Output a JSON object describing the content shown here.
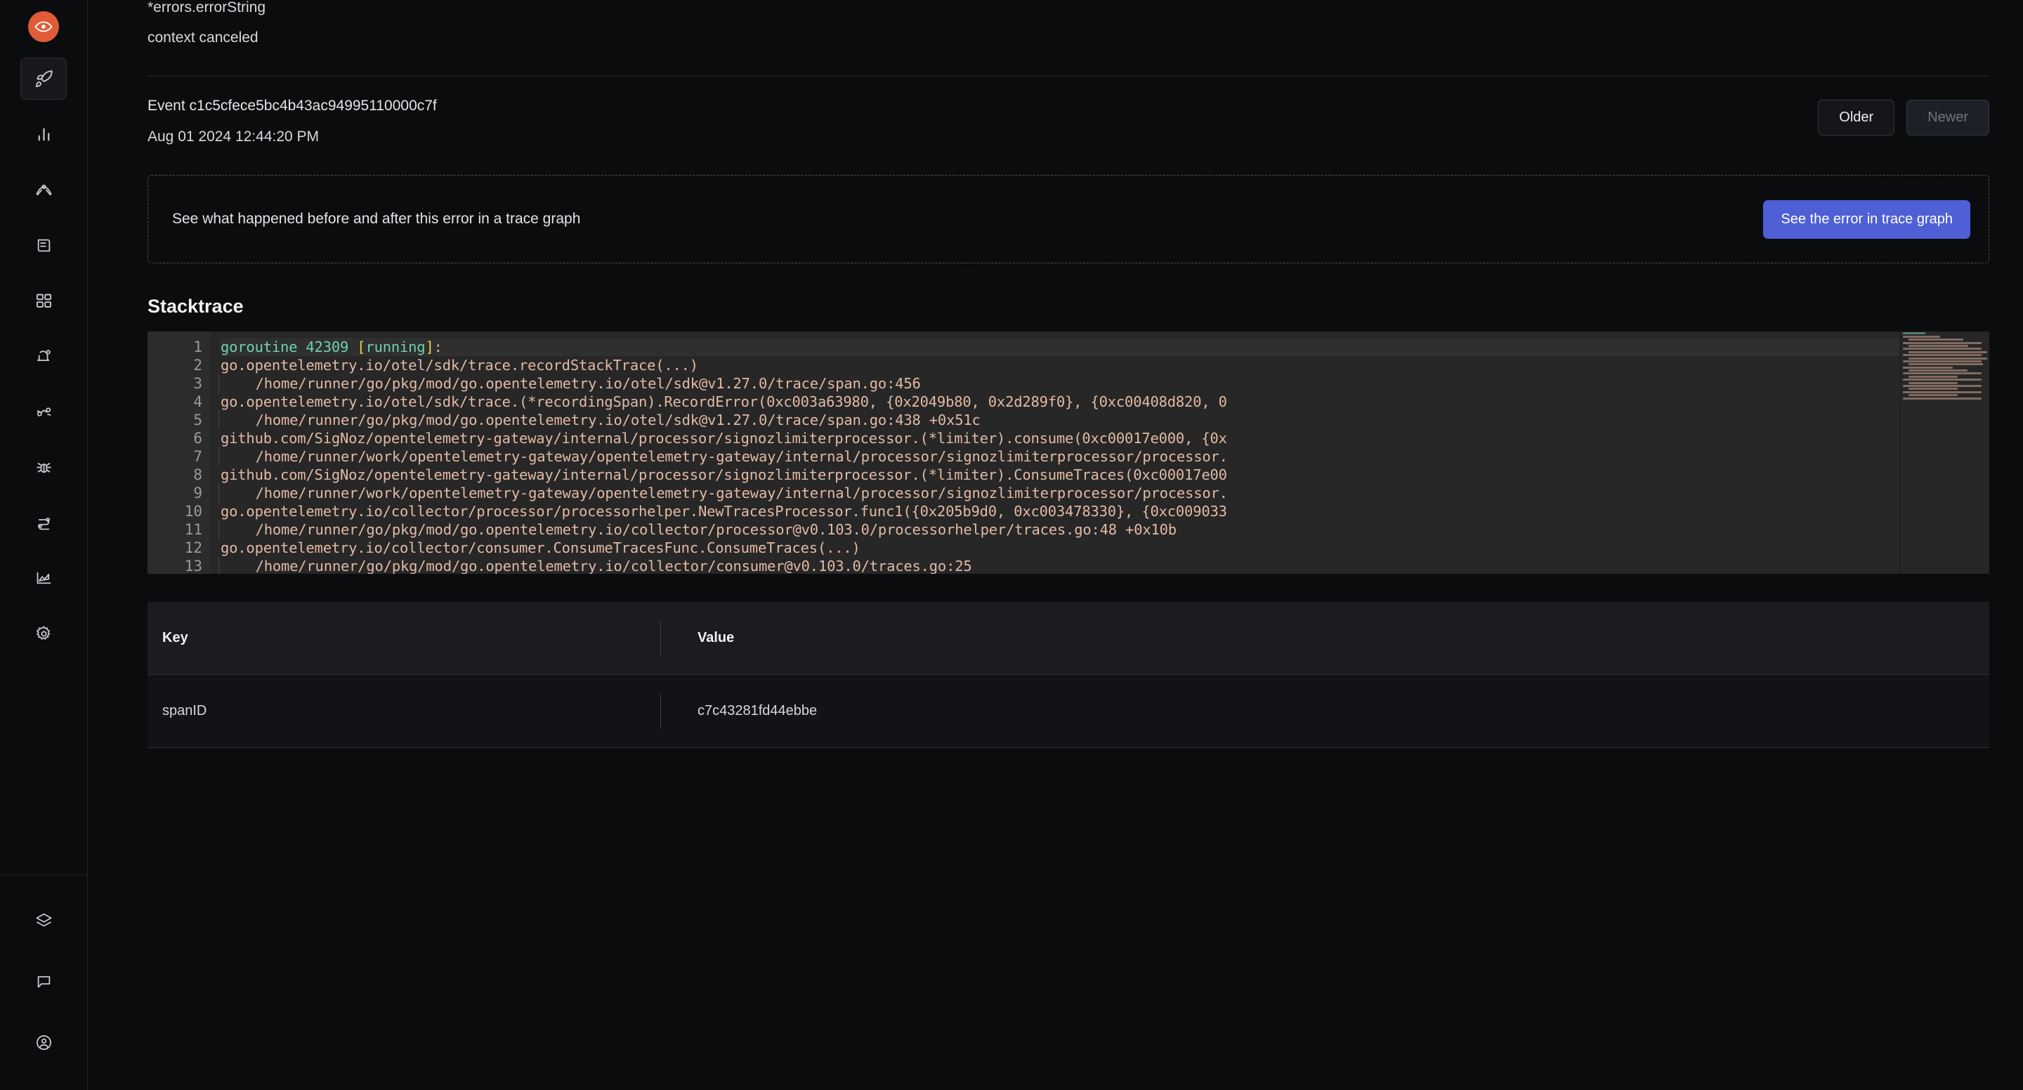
{
  "sidebar": {
    "logo": {
      "icon": "signoz-eye-logo-icon",
      "color": "#e05c38"
    },
    "items": [
      {
        "icon": "rocket-icon",
        "name": "get-started",
        "active": true
      },
      {
        "icon": "bar-chart-icon",
        "name": "services"
      },
      {
        "icon": "compass-trace-icon",
        "name": "traces"
      },
      {
        "icon": "logs-scroll-icon",
        "name": "logs"
      },
      {
        "icon": "grid-dashboard-icon",
        "name": "dashboards"
      },
      {
        "icon": "bell-alert-icon",
        "name": "alerts"
      },
      {
        "icon": "exceptions-icon",
        "name": "exceptions"
      },
      {
        "icon": "bug-icon",
        "name": "messaging-queues"
      },
      {
        "icon": "sliders-icon",
        "name": "service-map"
      },
      {
        "icon": "area-chart-icon",
        "name": "billing"
      },
      {
        "icon": "gear-icon",
        "name": "settings"
      }
    ],
    "bottom_items": [
      {
        "icon": "layers-icon",
        "name": "integrations"
      },
      {
        "icon": "message-icon",
        "name": "support"
      },
      {
        "icon": "user-circle-icon",
        "name": "account"
      }
    ]
  },
  "error": {
    "type": "*errors.errorString",
    "message": "context canceled"
  },
  "event": {
    "id_label": "Event c1c5cfece5bc4b43ac94995110000c7f",
    "timestamp": "Aug 01 2024 12:44:20 PM",
    "older_label": "Older",
    "newer_label": "Newer",
    "newer_disabled": true
  },
  "trace_banner": {
    "text": "See what happened before and after this error in a trace graph",
    "button_label": "See the error in trace graph",
    "button_color": "#4f5fd6"
  },
  "stacktrace": {
    "title": "Stacktrace",
    "lines": [
      {
        "n": 1,
        "highlight": true,
        "parts": [
          {
            "t": "goroutine 42309 ",
            "c": "green"
          },
          {
            "t": "[",
            "c": "yellow"
          },
          {
            "t": "running",
            "c": "green"
          },
          {
            "t": "]",
            "c": "yellow"
          },
          {
            "t": ":",
            "c": "plain"
          }
        ]
      },
      {
        "n": 2,
        "text": "go.opentelemetry.io/otel/sdk/trace.recordStackTrace(...)"
      },
      {
        "n": 3,
        "indent": true,
        "text": "    /home/runner/go/pkg/mod/go.opentelemetry.io/otel/sdk@v1.27.0/trace/span.go:456"
      },
      {
        "n": 4,
        "text": "go.opentelemetry.io/otel/sdk/trace.(*recordingSpan).RecordError(0xc003a63980, {0x2049b80, 0x2d289f0}, {0xc00408d820, 0"
      },
      {
        "n": 5,
        "indent": true,
        "text": "    /home/runner/go/pkg/mod/go.opentelemetry.io/otel/sdk@v1.27.0/trace/span.go:438 +0x51c"
      },
      {
        "n": 6,
        "text": "github.com/SigNoz/opentelemetry-gateway/internal/processor/signozlimiterprocessor.(*limiter).consume(0xc00017e000, {0x"
      },
      {
        "n": 7,
        "indent": true,
        "text": "    /home/runner/work/opentelemetry-gateway/opentelemetry-gateway/internal/processor/signozlimiterprocessor/processor."
      },
      {
        "n": 8,
        "text": "github.com/SigNoz/opentelemetry-gateway/internal/processor/signozlimiterprocessor.(*limiter).ConsumeTraces(0xc00017e00"
      },
      {
        "n": 9,
        "indent": true,
        "text": "    /home/runner/work/opentelemetry-gateway/opentelemetry-gateway/internal/processor/signozlimiterprocessor/processor."
      },
      {
        "n": 10,
        "text": "go.opentelemetry.io/collector/processor/processorhelper.NewTracesProcessor.func1({0x205b9d0, 0xc003478330}, {0xc009033"
      },
      {
        "n": 11,
        "indent": true,
        "text": "    /home/runner/go/pkg/mod/go.opentelemetry.io/collector/processor@v0.103.0/processorhelper/traces.go:48 +0x10b"
      },
      {
        "n": 12,
        "text": "go.opentelemetry.io/collector/consumer.ConsumeTracesFunc.ConsumeTraces(...)"
      },
      {
        "n": 13,
        "indent": true,
        "text": "    /home/runner/go/pkg/mod/go.opentelemetry.io/collector/consumer@v0.103.0/traces.go:25"
      }
    ]
  },
  "attributes_table": {
    "columns": [
      "Key",
      "Value"
    ],
    "rows": [
      {
        "key": "spanID",
        "value": "c7c43281fd44ebbe"
      }
    ]
  }
}
